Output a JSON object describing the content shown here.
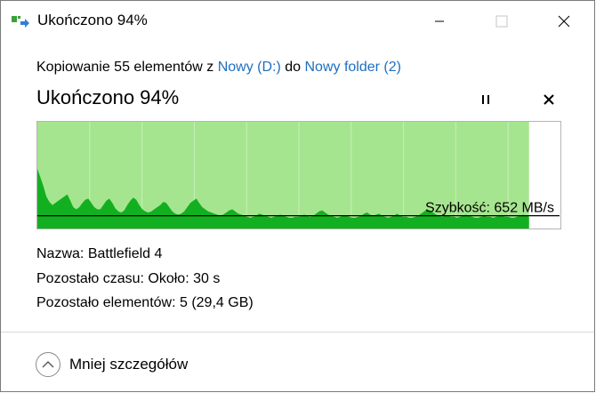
{
  "window": {
    "title": "Ukończono 94%",
    "minimize_icon": "minimize-icon",
    "maximize_icon": "maximize-icon",
    "close_icon": "close-icon"
  },
  "copy": {
    "prefix": "Kopiowanie 55 elementów z ",
    "source": "Nowy (D:)",
    "middle": " do ",
    "destination": "Nowy folder (2)"
  },
  "status": {
    "title": "Ukończono 94%",
    "percent_complete": 94,
    "pause_icon": "pause-icon",
    "cancel_icon": "cancel-icon"
  },
  "graph": {
    "speed_label": "Szybkość: 652 MB/s",
    "completed_color": "#a6e58f",
    "fill_color": "#12b020",
    "speed_series": [
      56,
      48,
      40,
      30,
      25,
      22,
      24,
      26,
      28,
      30,
      32,
      26,
      20,
      18,
      20,
      24,
      27,
      28,
      24,
      20,
      18,
      18,
      22,
      26,
      28,
      24,
      19,
      16,
      15,
      17,
      22,
      26,
      29,
      27,
      22,
      18,
      16,
      15,
      16,
      18,
      20,
      22,
      25,
      24,
      20,
      16,
      14,
      13,
      14,
      16,
      20,
      24,
      26,
      28,
      24,
      20,
      18,
      16,
      15,
      14,
      13,
      12,
      13,
      15,
      17,
      18,
      16,
      14,
      13,
      12,
      11,
      10,
      11,
      12,
      14,
      13,
      12,
      11,
      10,
      11,
      12,
      13,
      12,
      11,
      10,
      10,
      11,
      11,
      12,
      13,
      12,
      11,
      12,
      14,
      16,
      17,
      15,
      13,
      12,
      11,
      10,
      11,
      12,
      12,
      11,
      10,
      10,
      11,
      12,
      14,
      15,
      13,
      12,
      13,
      14,
      12,
      11,
      10,
      11,
      12,
      14,
      12,
      11,
      11,
      10,
      10,
      11,
      12,
      14,
      16,
      18,
      17,
      15,
      13,
      12,
      11,
      12,
      12,
      11,
      11,
      10,
      11,
      12,
      13,
      12,
      11,
      10,
      10,
      11,
      12,
      11,
      11,
      10,
      11,
      12,
      12,
      11,
      11,
      10,
      10,
      11,
      12,
      13,
      12,
      11
    ]
  },
  "details": {
    "name_label": "Nazwa:",
    "name_value": "Battlefield 4",
    "time_label": "Pozostało czasu:",
    "time_value": "Około: 30 s",
    "items_label": "Pozostało elementów:",
    "items_value": "5 (29,4 GB)"
  },
  "footer": {
    "less_details_label": "Mniej szczegółów",
    "chevron_icon": "chevron-up-icon"
  }
}
